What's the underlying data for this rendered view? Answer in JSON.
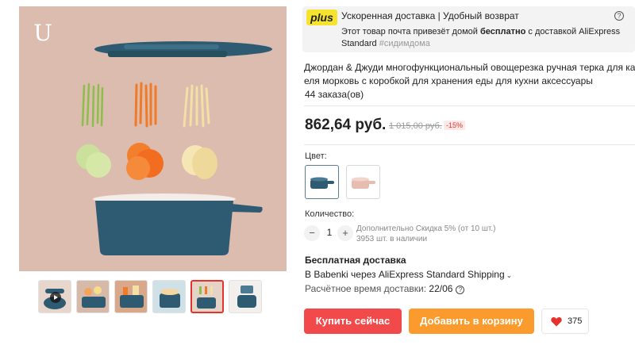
{
  "gallery": {
    "logo": "U",
    "thumbnails": [
      {
        "name": "video",
        "active": false
      },
      {
        "name": "image-2",
        "active": false
      },
      {
        "name": "image-3",
        "active": false
      },
      {
        "name": "image-4",
        "active": false
      },
      {
        "name": "image-5",
        "active": true
      },
      {
        "name": "image-6",
        "active": false
      }
    ]
  },
  "plus": {
    "badge": "plus",
    "title": "Ускоренная доставка | Удобный возврат",
    "line_prefix": "Этот товар почта привезёт домой ",
    "line_bold": "бесплатно",
    "line_suffix": " с доставкой AliExpress",
    "line3_text": "Standard ",
    "line3_tag": "#сидимдома",
    "help_icon": "question-circle-icon"
  },
  "product": {
    "title_line1": "Джордан & Джуди многофункциональный овощерезка ручная терка для картоф",
    "title_line2": "еля морковь с коробкой для хранения еды для кухни аксессуары",
    "orders": "44 заказа(ов)"
  },
  "price": {
    "current": "862,64 руб.",
    "old": "1 015,00 руб.",
    "discount": "-15%"
  },
  "color": {
    "label": "Цвет:",
    "options": [
      {
        "name": "blue",
        "selected": true,
        "hex": "#2e5a72"
      },
      {
        "name": "pink",
        "selected": false,
        "hex": "#e8bdb1"
      }
    ]
  },
  "quantity": {
    "label": "Количество:",
    "minus": "−",
    "value": "1",
    "plus": "+",
    "note_line1": "Дополнительно Скидка 5% (от 10 шт.)",
    "note_line2": "3953 шт. в наличии"
  },
  "shipping": {
    "title": "Бесплатная доставка",
    "method": "В Babenki через AliExpress Standard Shipping",
    "time_label": "Расчётное время доставки: ",
    "time_value": "22/06"
  },
  "actions": {
    "buy": "Купить сейчас",
    "cart": "Добавить в корзину",
    "wish_count": "375"
  },
  "colors": {
    "buy": "#f24a4a",
    "cart": "#fb9a2d",
    "plus_badge": "#f5e32d",
    "product_blue": "#2e5a72",
    "background_image": "#dcbcae"
  }
}
